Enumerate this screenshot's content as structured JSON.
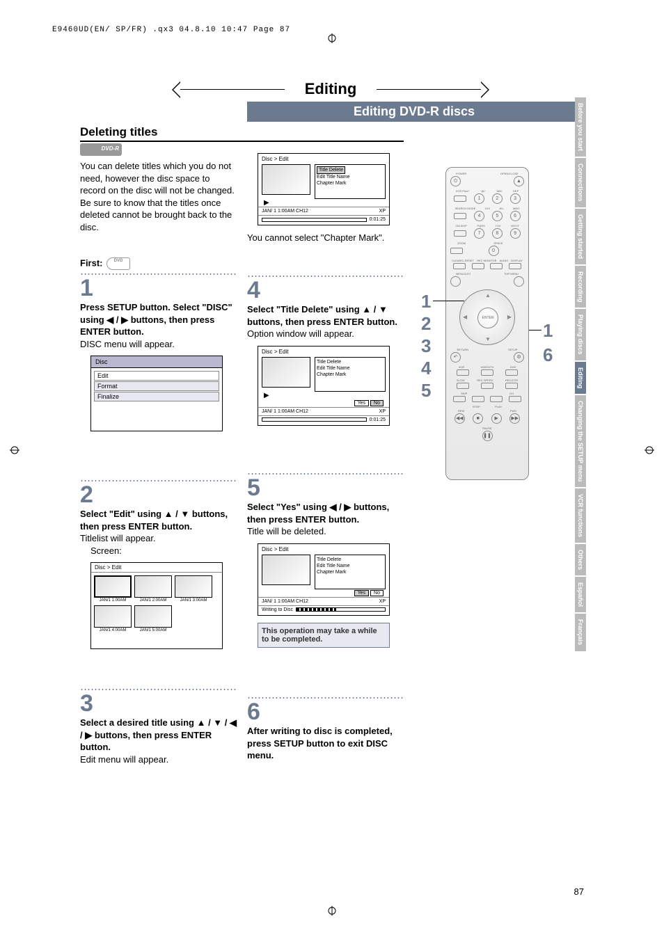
{
  "header_line": "E9460UD(EN/ SP/FR) .qx3  04.8.10  10:47  Page 87",
  "main_title": "Editing",
  "subtitle": "Editing DVD-R discs",
  "section_title": "Deleting titles",
  "dvd_r_badge": "DVD-R",
  "intro_text": "You can delete titles which you do not need, however the disc space to record on the disc will not be changed.\nBe sure to know that the titles once deleted cannot be brought back to the disc.",
  "first_label": "First:",
  "dvd_small_badge": "DVD",
  "step1": {
    "num": "1",
    "body_bold": "Press SETUP button. Select \"DISC\" using ◀ / ▶ buttons, then press ENTER button.",
    "body_plain": "DISC menu will appear."
  },
  "disc_screen": {
    "header": "Disc",
    "items": [
      "Edit",
      "Format",
      "Finalize"
    ]
  },
  "step2": {
    "num": "2",
    "body_bold": "Select \"Edit\" using ▲ / ▼ buttons, then press ENTER button.",
    "body_plain": "Titlelist will appear.",
    "screen_label": "Screen:"
  },
  "edit_screen": {
    "header": "Disc > Edit",
    "thumbs": [
      "JAN/1  1:00AM",
      "JAN/1  2:00AM",
      "JAN/1  3:00AM",
      "JAN/1  4:00AM",
      "JAN/1  5:00AM"
    ]
  },
  "step3": {
    "num": "3",
    "body_bold": "Select a desired title using ▲ / ▼ / ◀ / ▶ buttons, then press ENTER button.",
    "body_plain": "Edit menu will appear."
  },
  "osd1": {
    "header": "Disc > Edit",
    "menu": [
      "Title Delete",
      "Edit Title Name",
      "Chapter Mark"
    ],
    "status_left": "JAN/ 1   1:00AM  CH12",
    "status_right": "XP",
    "time": "0:01:25"
  },
  "osd1_note": "You cannot select \"Chapter Mark\".",
  "step4": {
    "num": "4",
    "body_bold": "Select \"Title Delete\" using ▲ / ▼ buttons, then press ENTER button.",
    "body_plain": "Option window will appear."
  },
  "osd2": {
    "header": "Disc > Edit",
    "menu": [
      "Title Delete",
      "Edit Title Name",
      "Chapter Mark"
    ],
    "yes": "Yes",
    "no": "No",
    "status_left": "JAN/ 1   1:00AM  CH12",
    "status_right": "XP",
    "time": "0:01:25"
  },
  "step5": {
    "num": "5",
    "body_bold": "Select \"Yes\" using ◀ / ▶ buttons, then press ENTER button.",
    "body_plain": "Title will be deleted."
  },
  "osd3": {
    "header": "Disc > Edit",
    "menu": [
      "Title Delete",
      "Edit Title Name",
      "Chapter Mark"
    ],
    "yes": "Yes",
    "no": "No",
    "status_left": "JAN/ 1   1:00AM  CH12",
    "status_right": "XP",
    "writing": "Writing to Disc"
  },
  "note_box": "This operation may take a while to be completed.",
  "step6": {
    "num": "6",
    "body_bold": "After writing to disc is completed, press SETUP button to exit DISC menu."
  },
  "remote": {
    "labels_row1": [
      "POWER",
      "",
      "",
      "OPEN/CLOSE"
    ],
    "labels_row2": [
      "VCR Plus+",
      "·@/:",
      "ABC",
      "DEF"
    ],
    "nums1": [
      "1",
      "2",
      "3"
    ],
    "labels_row3": [
      "SEARCH MODE",
      "GHI",
      "JKL",
      "MNO"
    ],
    "nums2": [
      "4",
      "5",
      "6"
    ],
    "labels_row4": [
      "CM SKIP",
      "PQRS",
      "TUV",
      "WXYZ"
    ],
    "nums3": [
      "7",
      "8",
      "9"
    ],
    "labels_row5": [
      "ZOOM",
      "",
      "SPACE",
      ""
    ],
    "num0": "0",
    "labels_row6": [
      "CLEAR/C-RESET",
      "REC MONITOR",
      "AUDIO",
      "DISPLAY"
    ],
    "labels_row7": [
      "MENU/LIST",
      "",
      "",
      "TOP MENU"
    ],
    "dpad_center": "ENTER",
    "labels_row8": [
      "RETURN",
      "",
      "",
      "SETUP"
    ],
    "labels_row9": [
      "VCR",
      "VIDEO/TV",
      "DVD"
    ],
    "labels_row10": [
      "SLOW",
      "REC SPEED",
      "REC/OTR"
    ],
    "labels_row11": [
      "SKIP",
      "",
      "CH"
    ],
    "labels_row12": [
      "STOP",
      "PLAY",
      ""
    ],
    "labels_row13": [
      "REW",
      "",
      "FWD"
    ],
    "labels_row14": [
      "",
      "PAUSE",
      ""
    ]
  },
  "left_pointers": [
    "1",
    "2",
    "3",
    "4",
    "5"
  ],
  "right_pointers": [
    "1",
    "6"
  ],
  "side_tabs": [
    {
      "label": "Before you start",
      "active": false
    },
    {
      "label": "Connections",
      "active": false
    },
    {
      "label": "Getting started",
      "active": false
    },
    {
      "label": "Recording",
      "active": false
    },
    {
      "label": "Playing discs",
      "active": false
    },
    {
      "label": "Editing",
      "active": true
    },
    {
      "label": "Changing the SETUP menu",
      "active": false
    },
    {
      "label": "VCR functions",
      "active": false
    },
    {
      "label": "Others",
      "active": false
    },
    {
      "label": "Español",
      "active": false
    },
    {
      "label": "Français",
      "active": false
    }
  ],
  "page_num": "87"
}
